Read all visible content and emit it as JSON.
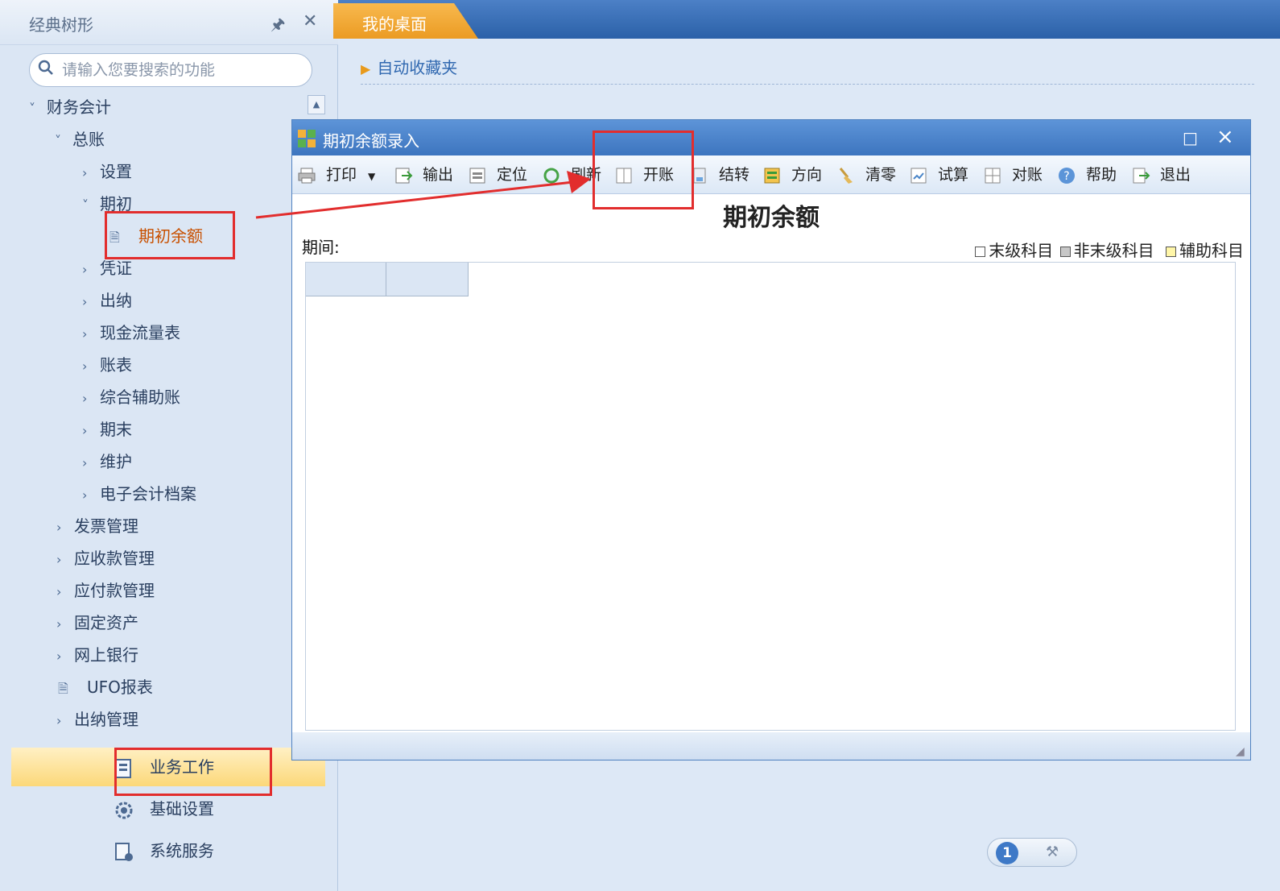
{
  "left_panel": {
    "title": "经典树形",
    "search_placeholder": "请输入您要搜索的功能",
    "tree": [
      {
        "label": "财务会计",
        "level": 0,
        "arrow": "down"
      },
      {
        "label": "总账",
        "level": 1,
        "arrow": "down"
      },
      {
        "label": "设置",
        "level": 2,
        "arrow": "right"
      },
      {
        "label": "期初",
        "level": 2,
        "arrow": "down"
      },
      {
        "label": "期初余额",
        "level": 3,
        "arrow": "doc"
      },
      {
        "label": "凭证",
        "level": 2,
        "arrow": "right"
      },
      {
        "label": "出纳",
        "level": 2,
        "arrow": "right"
      },
      {
        "label": "现金流量表",
        "level": 2,
        "arrow": "right"
      },
      {
        "label": "账表",
        "level": 2,
        "arrow": "right"
      },
      {
        "label": "综合辅助账",
        "level": 2,
        "arrow": "right"
      },
      {
        "label": "期末",
        "level": 2,
        "arrow": "right"
      },
      {
        "label": "维护",
        "level": 2,
        "arrow": "right"
      },
      {
        "label": "电子会计档案",
        "level": 2,
        "arrow": "right"
      },
      {
        "label": "发票管理",
        "level": 1,
        "arrow": "right"
      },
      {
        "label": "应收款管理",
        "level": 1,
        "arrow": "right"
      },
      {
        "label": "应付款管理",
        "level": 1,
        "arrow": "right"
      },
      {
        "label": "固定资产",
        "level": 1,
        "arrow": "right"
      },
      {
        "label": "网上银行",
        "level": 1,
        "arrow": "right"
      },
      {
        "label": "UFO报表",
        "level": 1,
        "arrow": "doc"
      },
      {
        "label": "出纳管理",
        "level": 1,
        "arrow": "right"
      }
    ],
    "nav_buttons": [
      "业务工作",
      "基础设置",
      "系统服务"
    ]
  },
  "tabs": {
    "desktop": "我的桌面"
  },
  "desktop": {
    "favorites": "自动收藏夹"
  },
  "dialog": {
    "title": "期初余额录入",
    "toolbar": [
      "打印",
      "输出",
      "定位",
      "刷新",
      "开账",
      "结转",
      "方向",
      "清零",
      "试算",
      "对账",
      "帮助",
      "退出"
    ],
    "heading": "期初余额",
    "period_label": "期间:",
    "legend": [
      "末级科目",
      "非末级科目",
      "辅助科目"
    ]
  },
  "pager": {
    "page": "1"
  },
  "colors": {
    "accent": "#3d75bf",
    "highlight": "#e22d2d",
    "tab": "#eb9b23"
  }
}
